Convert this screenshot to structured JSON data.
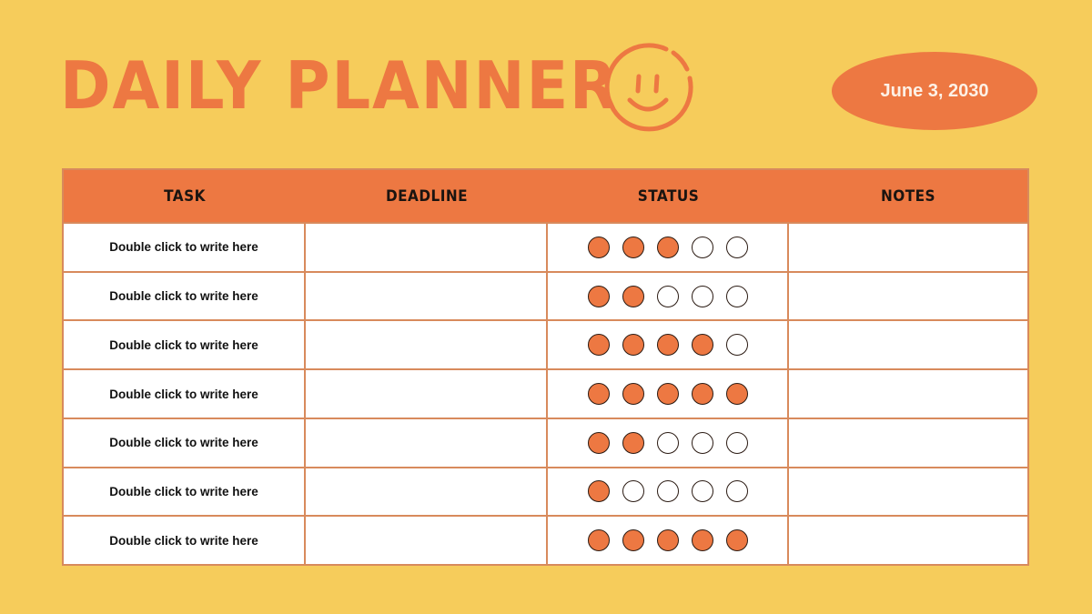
{
  "header": {
    "title": "DAILY PLANNER",
    "icon": "smiley-face-icon",
    "date": "June 3, 2030"
  },
  "colors": {
    "background": "#f6cc5b",
    "accent": "#ed7842",
    "border": "#d88a5c",
    "cell": "#ffffff",
    "text": "#111111"
  },
  "table": {
    "columns": [
      "TASK",
      "DEADLINE",
      "STATUS",
      "NOTES"
    ],
    "status_scale_max": 5,
    "rows": [
      {
        "task": "Double click to write here",
        "deadline": "",
        "status": 3,
        "notes": ""
      },
      {
        "task": "Double click to write here",
        "deadline": "",
        "status": 2,
        "notes": ""
      },
      {
        "task": "Double click to write here",
        "deadline": "",
        "status": 4,
        "notes": ""
      },
      {
        "task": "Double click to write here",
        "deadline": "",
        "status": 5,
        "notes": ""
      },
      {
        "task": "Double click to write here",
        "deadline": "",
        "status": 2,
        "notes": ""
      },
      {
        "task": "Double click to write here",
        "deadline": "",
        "status": 1,
        "notes": ""
      },
      {
        "task": "Double click to write here",
        "deadline": "",
        "status": 5,
        "notes": ""
      }
    ]
  }
}
